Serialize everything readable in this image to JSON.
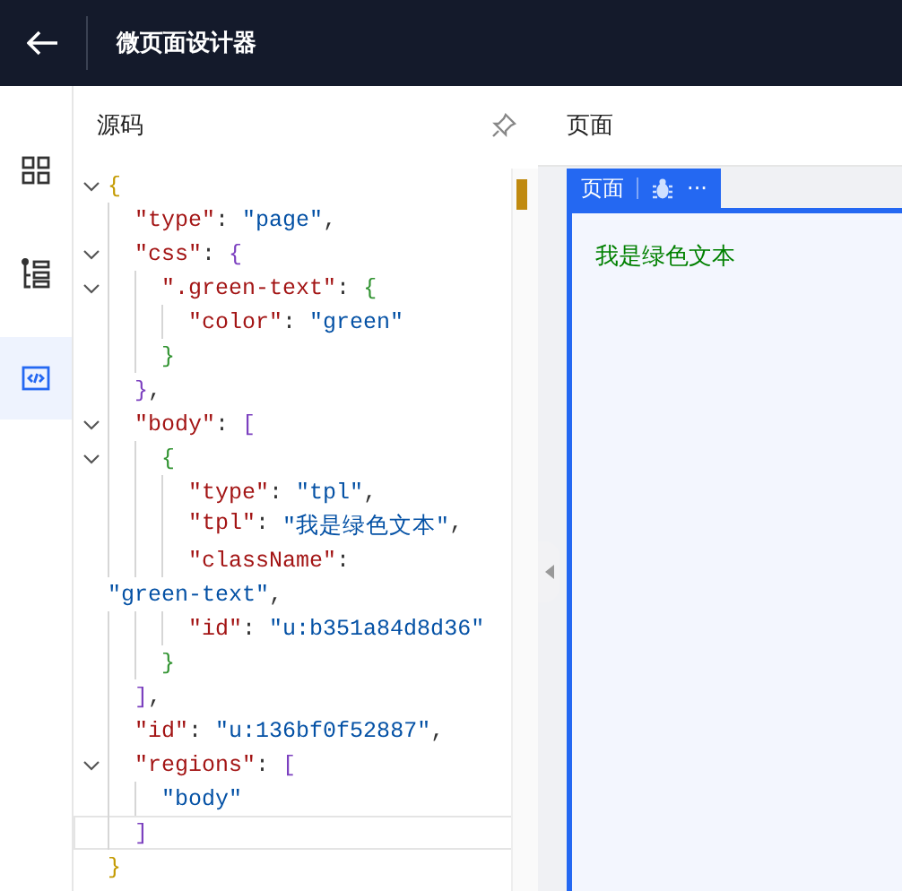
{
  "header": {
    "title": "微页面设计器"
  },
  "rail": [
    {
      "kind": "grid",
      "selected": false
    },
    {
      "kind": "outline",
      "selected": false
    },
    {
      "kind": "code",
      "selected": true
    }
  ],
  "code_panel": {
    "title": "源码",
    "lines": [
      {
        "fold": true,
        "current": false,
        "text": "{"
      },
      {
        "fold": false,
        "current": false,
        "text": "  \"type\": \"page\","
      },
      {
        "fold": true,
        "current": false,
        "text": "  \"css\": {"
      },
      {
        "fold": true,
        "current": false,
        "text": "    \".green-text\": {"
      },
      {
        "fold": false,
        "current": false,
        "text": "      \"color\": \"green\""
      },
      {
        "fold": false,
        "current": false,
        "text": "    }"
      },
      {
        "fold": false,
        "current": false,
        "text": "  },"
      },
      {
        "fold": true,
        "current": false,
        "text": "  \"body\": ["
      },
      {
        "fold": true,
        "current": false,
        "text": "    {"
      },
      {
        "fold": false,
        "current": false,
        "text": "      \"type\": \"tpl\","
      },
      {
        "fold": false,
        "current": false,
        "text": "      \"tpl\": \"我是绿色文本\","
      },
      {
        "fold": false,
        "current": false,
        "text": "      \"className\":"
      },
      {
        "fold": false,
        "current": false,
        "text": "\"green-text\","
      },
      {
        "fold": false,
        "current": false,
        "text": "      \"id\": \"u:b351a84d8d36\""
      },
      {
        "fold": false,
        "current": false,
        "text": "    }"
      },
      {
        "fold": false,
        "current": false,
        "text": "  ],"
      },
      {
        "fold": false,
        "current": false,
        "text": "  \"id\": \"u:136bf0f52887\","
      },
      {
        "fold": true,
        "current": false,
        "text": "  \"regions\": ["
      },
      {
        "fold": false,
        "current": false,
        "text": "    \"body\""
      },
      {
        "fold": false,
        "current": true,
        "text": "  ]"
      },
      {
        "fold": false,
        "current": false,
        "text": "}"
      }
    ]
  },
  "preview": {
    "title": "页面",
    "tab_label": "页面",
    "more": "···",
    "content": "我是绿色文本"
  }
}
